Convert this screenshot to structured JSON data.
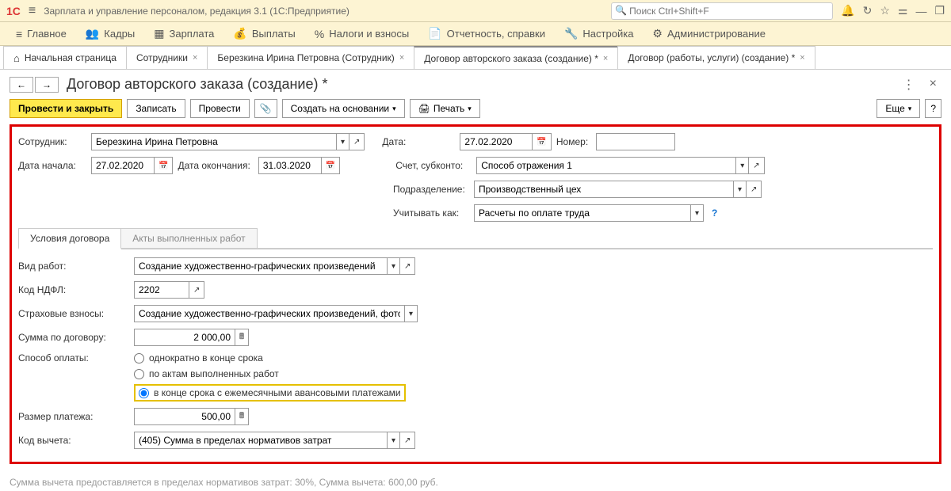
{
  "app": {
    "title": "Зарплата и управление персоналом, редакция 3.1  (1С:Предприятие)",
    "search_placeholder": "Поиск Ctrl+Shift+F"
  },
  "main_menu": {
    "main": "Главное",
    "personnel": "Кадры",
    "salary": "Зарплата",
    "payments": "Выплаты",
    "taxes": "Налоги и взносы",
    "reports": "Отчетность, справки",
    "settings": "Настройка",
    "admin": "Администрирование"
  },
  "tabs": {
    "home": "Начальная страница",
    "t1": "Сотрудники",
    "t2": "Березкина Ирина Петровна (Сотрудник)",
    "t3": "Договор авторского заказа (создание) *",
    "t4": "Договор (работы, услуги) (создание) *"
  },
  "page": {
    "title": "Договор авторского заказа (создание) *"
  },
  "toolbar": {
    "post_close": "Провести и закрыть",
    "save": "Записать",
    "post": "Провести",
    "create_based": "Создать на основании",
    "print": "Печать",
    "more": "Еще"
  },
  "form": {
    "employee_lbl": "Сотрудник:",
    "employee": "Березкина Ирина Петровна",
    "date_lbl": "Дата:",
    "date": "27.02.2020",
    "number_lbl": "Номер:",
    "number": "",
    "start_lbl": "Дата начала:",
    "start": "27.02.2020",
    "end_lbl": "Дата окончания:",
    "end": "31.03.2020",
    "account_lbl": "Счет, субконто:",
    "account": "Способ отражения 1",
    "dept_lbl": "Подразделение:",
    "dept": "Производственный цех",
    "consider_lbl": "Учитывать как:",
    "consider": "Расчеты по оплате труда"
  },
  "section_tabs": {
    "t1": "Условия договора",
    "t2": "Акты выполненных работ"
  },
  "details": {
    "work_type_lbl": "Вид работ:",
    "work_type": "Создание художественно-графических произведений",
    "ndfl_lbl": "Код НДФЛ:",
    "ndfl": "2202",
    "insurance_lbl": "Страховые взносы:",
    "insurance": "Создание художественно-графических произведений, фотораб",
    "sum_lbl": "Сумма по договору:",
    "sum": "2 000,00",
    "pay_method_lbl": "Способ оплаты:",
    "pay_opt1": "однократно в конце срока",
    "pay_opt2": "по актам выполненных работ",
    "pay_opt3": "в конце срока с ежемесячными авансовыми платежами",
    "payment_size_lbl": "Размер платежа:",
    "payment_size": "500,00",
    "deduction_lbl": "Код вычета:",
    "deduction": "(405) Сумма в пределах нормативов затрат"
  },
  "footer": "Сумма вычета предоставляется в пределах нормативов затрат: 30%,  Сумма вычета: 600,00 руб."
}
